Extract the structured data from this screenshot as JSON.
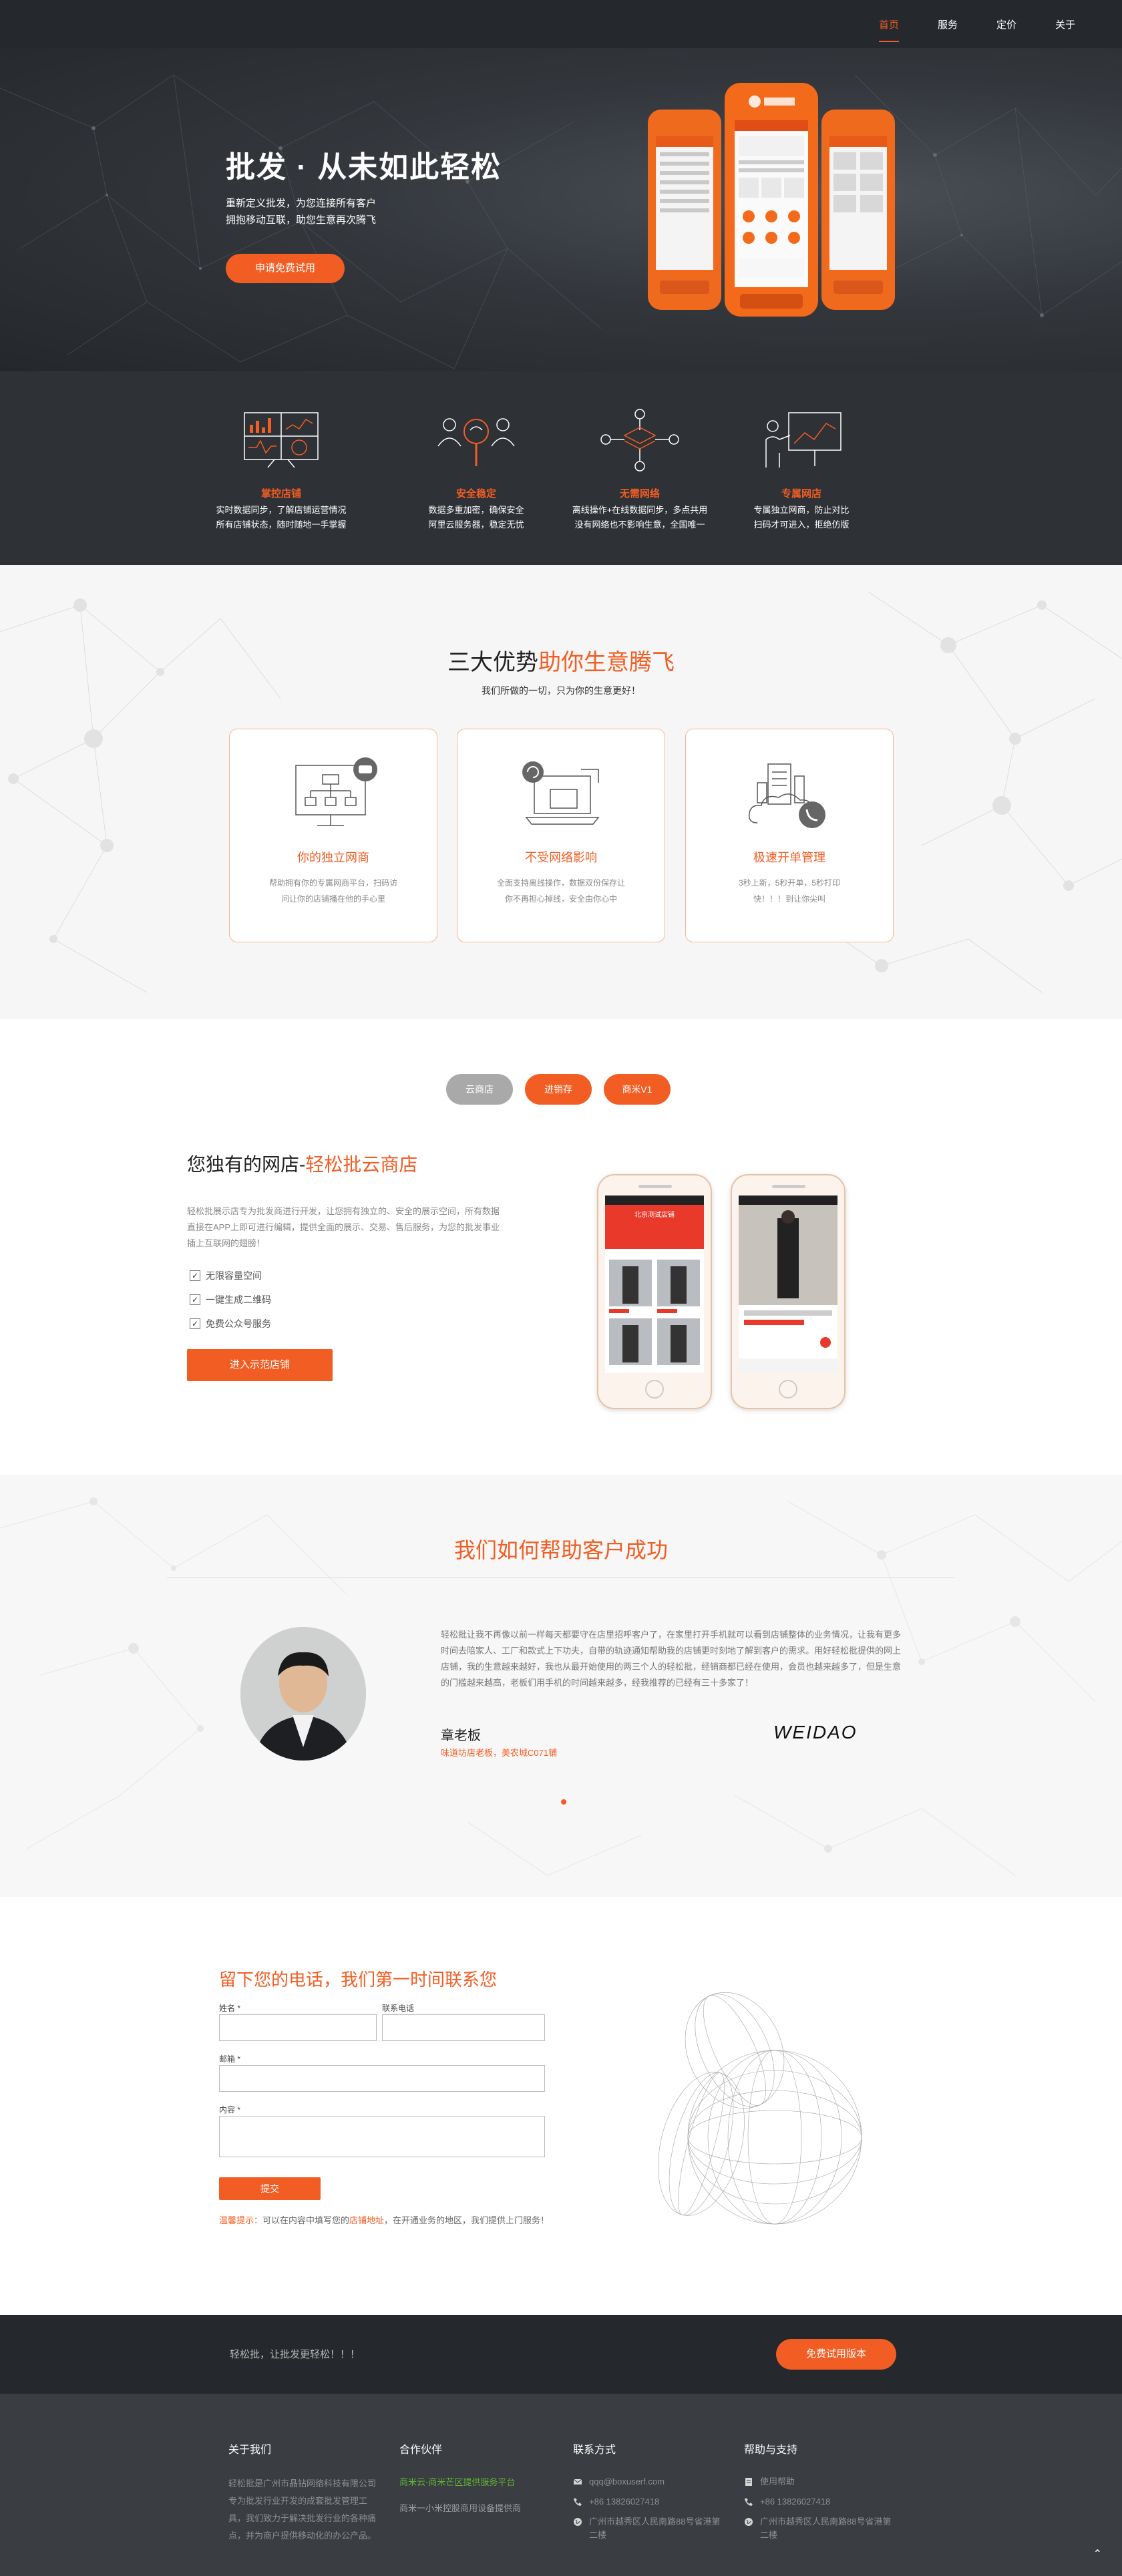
{
  "nav": {
    "items": [
      "首页",
      "服务",
      "定价",
      "关于"
    ]
  },
  "hero": {
    "title": "批发 · 从未如此轻松",
    "subtitle_1": "重新定义批发，为您连接所有客户",
    "subtitle_2": "拥抱移动互联，助您生意再次腾飞",
    "cta": "申请免费试用"
  },
  "features": [
    {
      "title": "掌控店铺",
      "line1": "实时数据同步，了解店铺运营情况",
      "line2": "所有店铺状态，随时随地一手掌握"
    },
    {
      "title": "安全稳定",
      "line1": "数据多重加密，确保安全",
      "line2": "阿里云服务器，稳定无忧"
    },
    {
      "title": "无需网络",
      "line1": "离线操作+在线数据同步，多点共用",
      "line2": "没有网络也不影响生意，全国唯一"
    },
    {
      "title": "专属网店",
      "line1": "专属独立网商，防止对比",
      "line2": "扫码才可进入，拒绝仿版"
    }
  ],
  "advantages": {
    "title_plain": "三大优势",
    "title_accent": "助你生意腾飞",
    "subtitle": "我们所做的一切，只为你的生意更好！",
    "cards": [
      {
        "title": "你的独立网商",
        "desc": "帮助拥有你的专属网商平台，扫码访问让你的店铺播在他的手心里"
      },
      {
        "title": "不受网络影响",
        "desc": "全面支持离线操作，数据双份保存让你不再担心掉线，安全由你心中"
      },
      {
        "title": "极速开单管理",
        "desc": "3秒上新，5秒开单，5秒打印快！！！到让你尖叫"
      }
    ]
  },
  "shop": {
    "tabs": [
      "云商店",
      "进销存",
      "商米V1"
    ],
    "title_plain": "您独有的网店-",
    "title_accent": "轻松批云商店",
    "desc": "轻松批展示店专为批发商进行开发，让您拥有独立的、安全的展示空间，所有数据直接在APP上即可进行编辑，提供全面的展示、交易、售后服务，为您的批发事业插上互联网的翅膀！",
    "checks": [
      "无限容量空间",
      "一键生成二维码",
      "免费公众号服务"
    ],
    "cta": "进入示范店铺",
    "phone_header": "北京测试店铺"
  },
  "testimonial": {
    "title": "我们如何帮助客户成功",
    "text": "轻松批让我不再像以前一样每天都要守在店里招呼客户了，在家里打开手机就可以看到店铺整体的业务情况，让我有更多时间去陪家人、工厂和款式上下功夫，自带的轨迹通知帮助我的店铺更时刻地了解到客户的需求。用好轻松批提供的网上店铺，我的生意越来越好，我也从最开始使用的两三个人的轻松批，经销商都已经在使用，会员也越来越多了，但是生意的门槛越来越高，老板们用手机的时间越来越多，经我推荐的已经有三十多家了！",
    "name": "章老板",
    "company": "味道坊店老板，美农城C071铺",
    "logo": "WEIDAO"
  },
  "contact": {
    "title": "留下您的电话，我们第一时间联系您",
    "name_label": "姓名 *",
    "phone_label": "联系电话",
    "email_label": "邮箱 *",
    "content_label": "内容 *",
    "submit": "提交",
    "note_label": "温馨提示：",
    "note_1": "可以在内容中填写您的",
    "note_accent": "店铺地址",
    "note_2": "，在开通业务的地区，我们提供上门服务！"
  },
  "cta": {
    "text": "轻松批，让批发更轻松！！！",
    "button": "免费试用版本"
  },
  "footer": {
    "about_title": "关于我们",
    "about_text": "轻松批是广州市晶钻网络科技有限公司专为批发行业开发的成套批发管理工具，我们致力于解决批发行业的各种痛点，并为商户提供移动化的办公产品。",
    "partners_title": "合作伙伴",
    "partner_1": "商米云-商米芒区提供服务平台",
    "partner_2": "商米一小米控股商用设备提供商",
    "contact_title": "联系方式",
    "email": "qqq@boxuserf.com",
    "phone": "+86 13826027418",
    "address": "广州市越秀区人民南路88号省港第二楼",
    "support_title": "帮助与支持",
    "help": "使用帮助",
    "support_phone": "+86 13826027418",
    "support_address": "广州市越秀区人民南路88号省港第二楼",
    "to_top": "⌃"
  },
  "colors": {
    "accent": "#f25d23",
    "dark": "#25282c",
    "footer": "#3a3d42"
  }
}
